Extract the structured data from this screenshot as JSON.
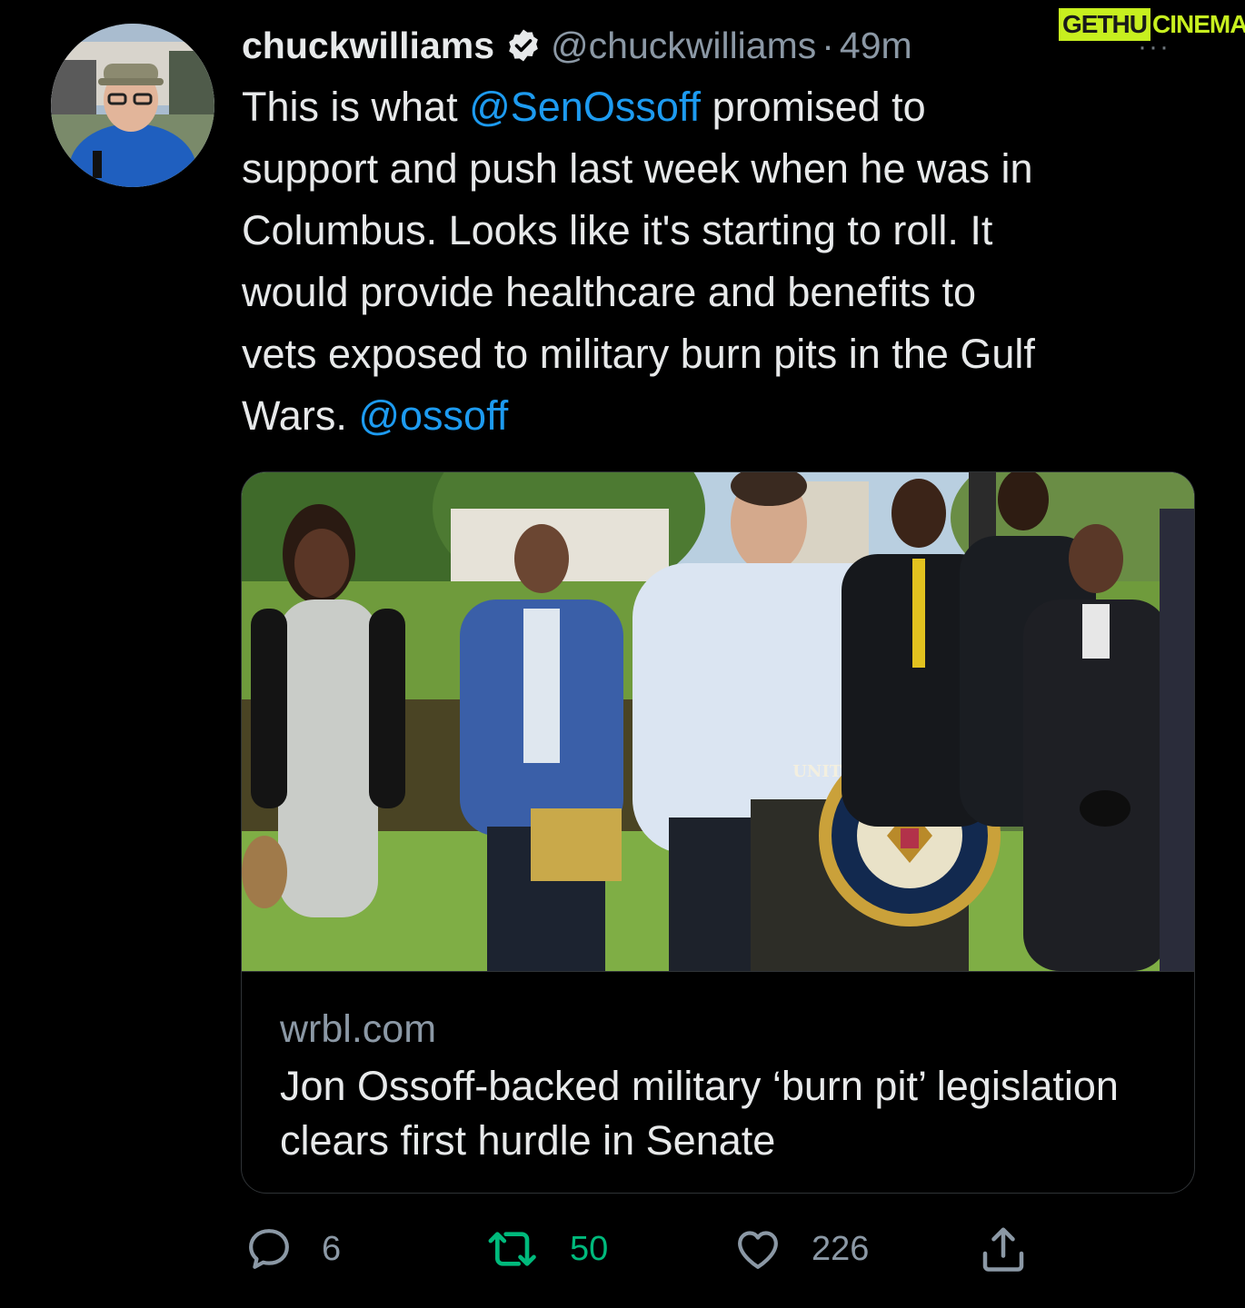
{
  "watermark": {
    "part1": "GETHU",
    "part2": "CINEMA"
  },
  "tweet": {
    "display_name": "chuckwilliams",
    "handle": "@chuckwilliams",
    "separator": "·",
    "time": "49m",
    "more_label": "···",
    "text_1": "This is what ",
    "mention_1": "@SenOssoff",
    "text_2": "  promised to\nsupport and push last week when he was in\nColumbus. Looks like it's starting to roll. It\nwould provide healthcare and benefits to\nvets exposed to military burn pits in the Gulf\nWars. ",
    "mention_2": "@ossoff"
  },
  "card": {
    "domain": "wrbl.com",
    "title": "Jon Ossoff-backed military ‘burn pit’ legislation clears first hurdle in Senate",
    "seal_text": "UNITED STATES SENATE"
  },
  "actions": {
    "replies": "6",
    "retweets": "50",
    "likes": "226"
  },
  "colors": {
    "background": "#000000",
    "mention": "#1d9bf0",
    "retweet_active": "#00ba7c",
    "secondary": "#8b98a5",
    "watermark": "#c7ef1f"
  },
  "icons": [
    "verified-badge-icon",
    "more-icon",
    "reply-icon",
    "retweet-icon",
    "like-icon",
    "share-icon"
  ]
}
